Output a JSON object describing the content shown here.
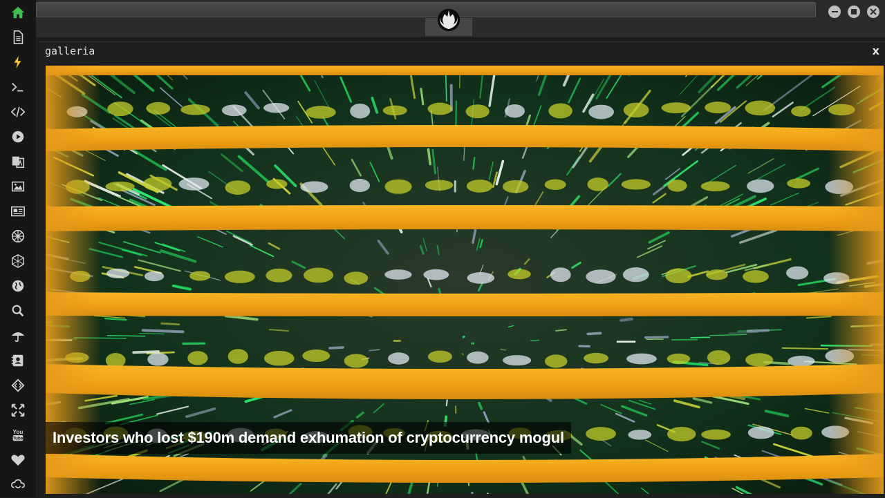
{
  "window": {
    "title": "galleria",
    "close_label": "x"
  },
  "gallery": {
    "caption": "Investors who lost $190m demand exhumation of cryptocurrency mogul"
  },
  "sidebar": {
    "items": [
      {
        "name": "home",
        "icon": "home-icon",
        "color": "#3fbf4f"
      },
      {
        "name": "document",
        "icon": "document-icon"
      },
      {
        "name": "lightning",
        "icon": "lightning-icon",
        "color": "#f2c230"
      },
      {
        "name": "terminal",
        "icon": "terminal-icon",
        "glyph": ">_"
      },
      {
        "name": "code",
        "icon": "code-icon",
        "glyph": "</>"
      },
      {
        "name": "play",
        "icon": "play-icon"
      },
      {
        "name": "translate",
        "icon": "translate-icon"
      },
      {
        "name": "image",
        "icon": "image-icon"
      },
      {
        "name": "news",
        "icon": "newspaper-icon"
      },
      {
        "name": "empire",
        "icon": "empire-icon"
      },
      {
        "name": "hexagon",
        "icon": "hexagon-icon"
      },
      {
        "name": "globe",
        "icon": "globe-icon"
      },
      {
        "name": "search",
        "icon": "search-icon"
      },
      {
        "name": "umbrella",
        "icon": "umbrella-icon"
      },
      {
        "name": "contacts",
        "icon": "contact-book-icon"
      },
      {
        "name": "dev",
        "icon": "dev-diamond-icon"
      },
      {
        "name": "expand",
        "icon": "expand-icon"
      },
      {
        "name": "youtube",
        "icon": "youtube-icon",
        "label": "You Tube"
      },
      {
        "name": "heart",
        "icon": "heart-icon"
      },
      {
        "name": "cloud",
        "icon": "cloud-link-icon"
      }
    ]
  },
  "topbar": {
    "logo_icon": "rebel-alliance-logo-icon"
  },
  "colors": {
    "accent_green": "#3fbf4f",
    "accent_yellow": "#f2c230",
    "rack_orange": "#f0a417",
    "led_green": "#22d05a"
  }
}
